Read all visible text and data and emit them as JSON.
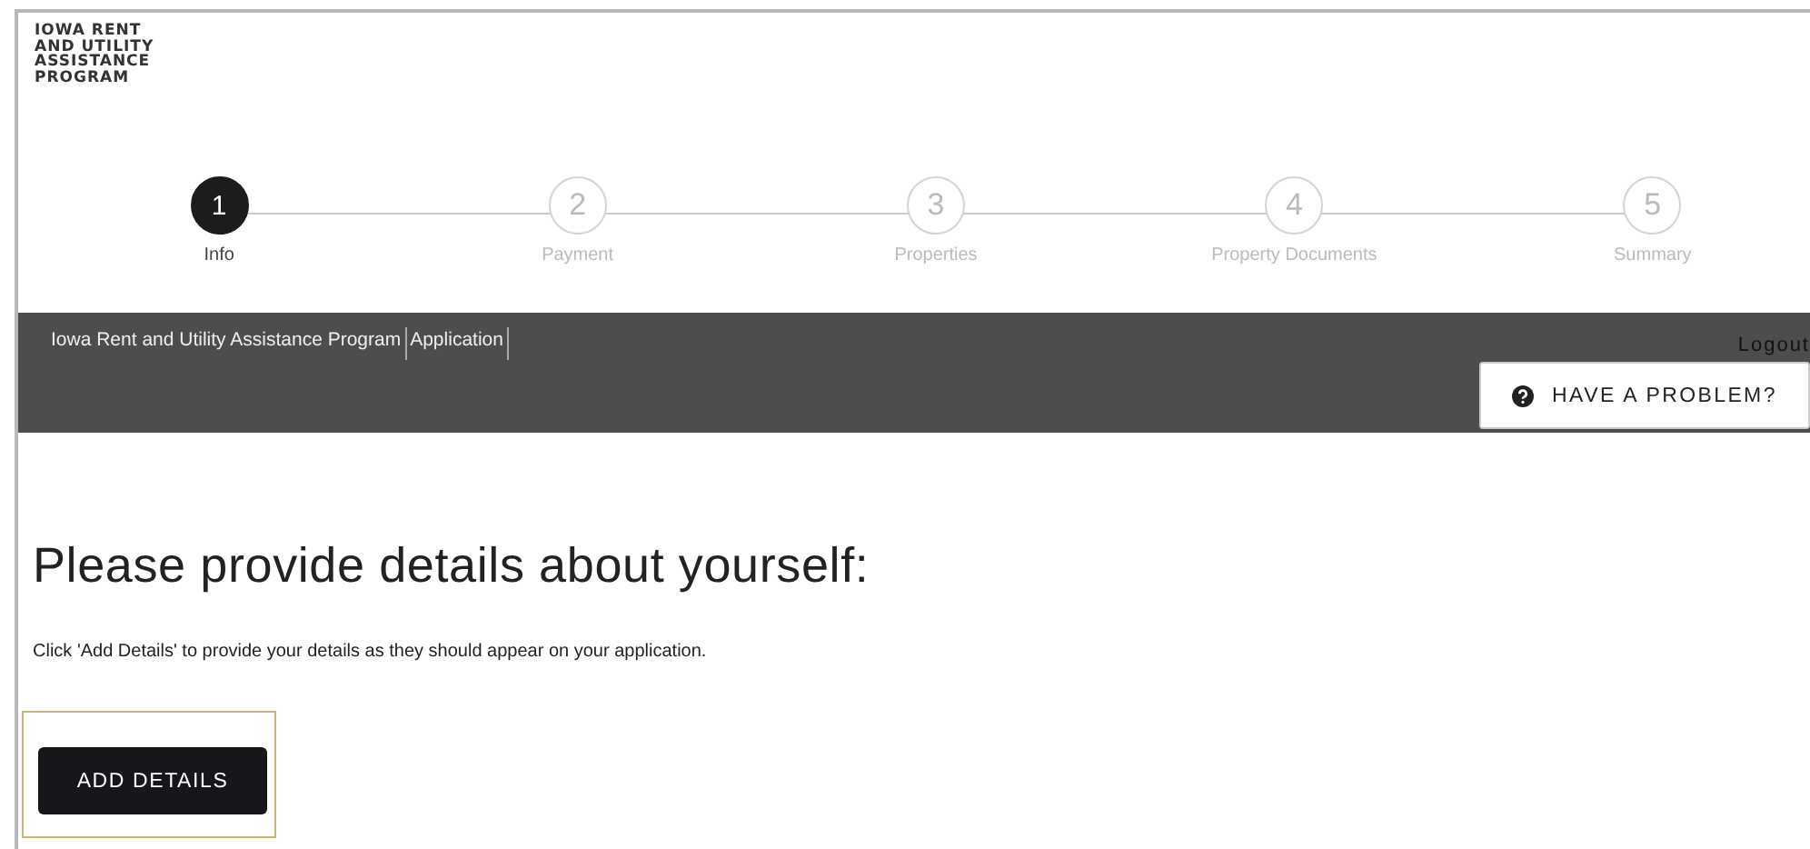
{
  "logo": [
    "IOWA RENT",
    "AND UTILITY",
    "ASSISTANCE",
    "PROGRAM"
  ],
  "steps": [
    {
      "number": "1",
      "label": "Info",
      "selected": true
    },
    {
      "number": "2",
      "label": "Payment",
      "selected": false
    },
    {
      "number": "3",
      "label": "Properties",
      "selected": false
    },
    {
      "number": "4",
      "label": "Property Documents",
      "selected": false
    },
    {
      "number": "5",
      "label": "Summary",
      "selected": false
    }
  ],
  "breadcrumbs": [
    "Iowa Rent and Utility Assistance Program",
    "Application"
  ],
  "logout": "Logout",
  "help_button": "HAVE A PROBLEM?",
  "heading": "Please provide details about yourself:",
  "instructions": "Click 'Add Details' to provide your details as they should appear on your application.",
  "add_button": "ADD DETAILS"
}
